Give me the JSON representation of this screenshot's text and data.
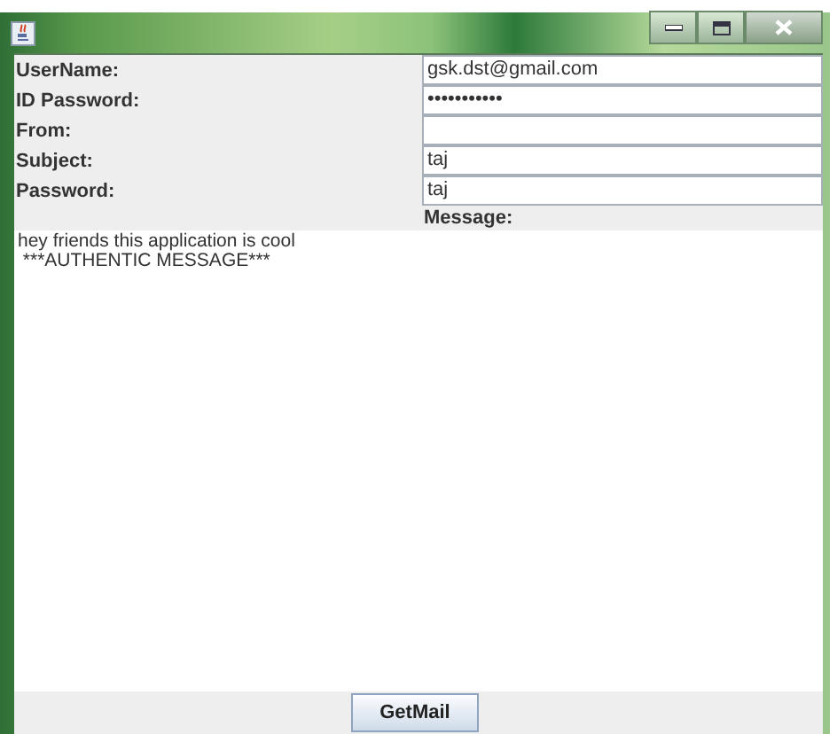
{
  "fields": [
    {
      "label": "UserName:",
      "value": "gsk.dst@gmail.com"
    },
    {
      "label": "ID Password:",
      "value": "•••••••••••"
    },
    {
      "label": "From:"
    },
    {
      "label": "Subject:",
      "value": "taj"
    },
    {
      "label": "Password:",
      "value": "taj"
    }
  ],
  "message_label": "Message:",
  "message": "hey friends this application is cool\n ***AUTHENTIC MESSAGE***",
  "button": "GetMail"
}
